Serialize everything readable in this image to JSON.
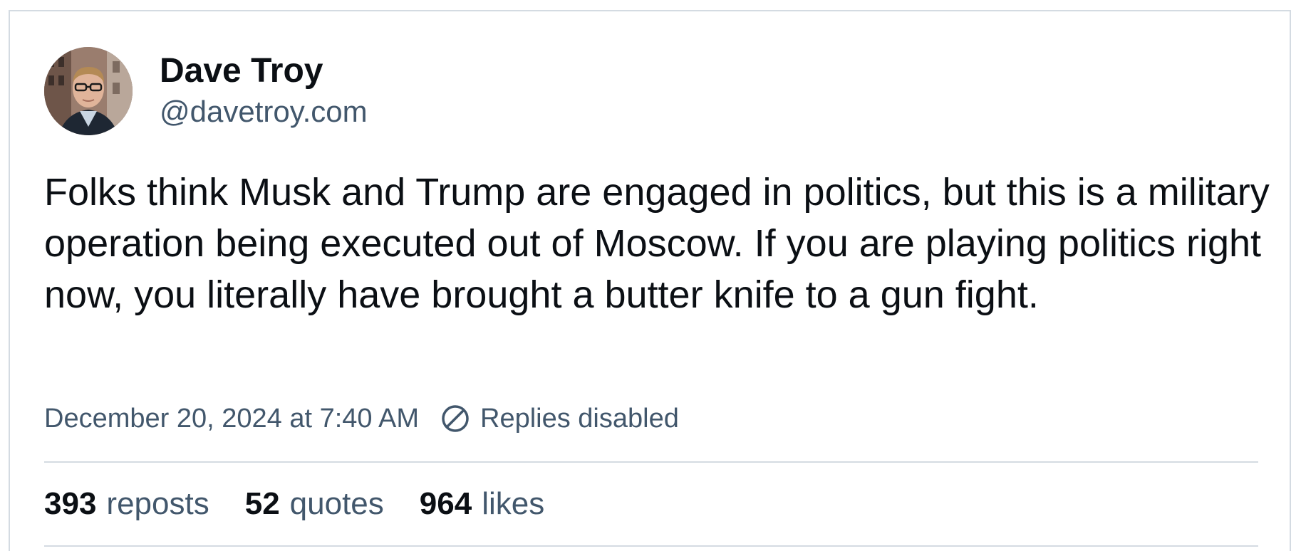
{
  "post": {
    "author": {
      "display_name": "Dave Troy",
      "handle": "@davetroy.com",
      "avatar_icon": "avatar-photo"
    },
    "text": "Folks think Musk and Trump are engaged in politics, but this is a military operation being executed out of Moscow. If you are playing politics right now, you literally have brought a butter knife to a gun fight.",
    "timestamp": "December 20, 2024 at 7:40 AM",
    "replies_status": {
      "icon": "no-entry-icon",
      "label": "Replies disabled"
    },
    "stats": {
      "reposts": {
        "count": "393",
        "label": "reposts"
      },
      "quotes": {
        "count": "52",
        "label": "quotes"
      },
      "likes": {
        "count": "964",
        "label": "likes"
      }
    }
  },
  "colors": {
    "primary_text": "#0b0f14",
    "secondary_text": "#42576c",
    "border": "#d4dbe2",
    "background": "#ffffff"
  }
}
